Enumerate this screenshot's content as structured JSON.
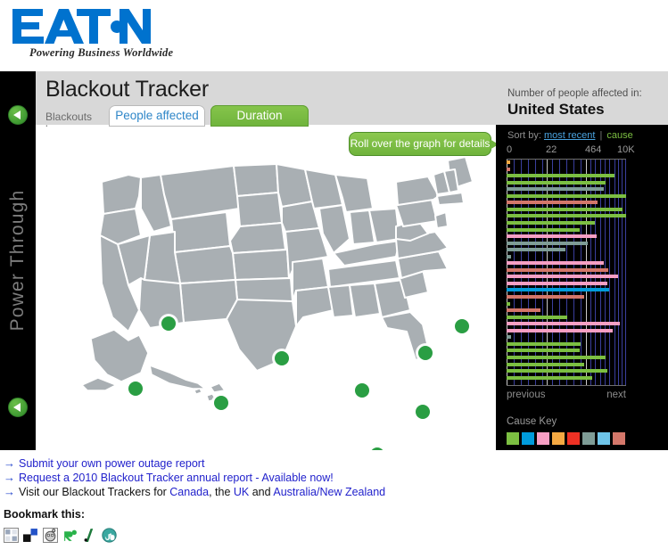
{
  "brand": {
    "logo_text": "EATON",
    "tagline": "Powering Business Worldwide"
  },
  "rail": {
    "vertical_text": "Power Through",
    "top_button": "previous-arrow",
    "bottom_button": "previous-arrow"
  },
  "header": {
    "title": "Blackout Tracker",
    "tabs_prefix": "Blackouts by:",
    "tabs": [
      {
        "label": "People affected",
        "active": true
      },
      {
        "label": "Duration",
        "active": false
      }
    ]
  },
  "map": {
    "callout": "Roll over the graph for details",
    "marker_count": 9,
    "land_color": "#A9AFB3",
    "border_color": "#FFFFFF",
    "marker_color": "#2A9E43"
  },
  "panel": {
    "subtitle": "Number of people affected in:",
    "region": "United States",
    "sort_label": "Sort by:",
    "sort_options": [
      {
        "label": "most recent",
        "active": true,
        "color": "#4AA3E0"
      },
      {
        "label": "cause",
        "active": false,
        "color": "#7CBF42"
      }
    ],
    "sort_separator": "|",
    "previous_label": "previous",
    "next_label": "next",
    "cause_key_title": "Cause Key",
    "cause_key_colors": [
      "#7CBF42",
      "#009BDB",
      "#F79FC4",
      "#F5A942",
      "#EE3124",
      "#7E9C96",
      "#6EC4E8",
      "#D4776A"
    ]
  },
  "chart_data": {
    "type": "bar",
    "orientation": "horizontal",
    "title": "Number of people affected in: United States",
    "xlabel": "",
    "ylabel": "",
    "scale": "log",
    "tick_labels": [
      "0",
      "22",
      "464",
      "10K"
    ],
    "tick_positions_pct": [
      0,
      33.3,
      66.6,
      100
    ],
    "grid": true,
    "legend_position": "below-chart",
    "legend_title": "Cause Key",
    "legend_entries": [
      "#7CBF42",
      "#009BDB",
      "#F79FC4",
      "#F5A942",
      "#EE3124",
      "#7E9C96",
      "#6EC4E8",
      "#D4776A"
    ],
    "values": [
      3,
      3,
      90,
      83,
      81,
      100,
      76,
      97,
      100,
      74,
      61,
      75,
      68,
      49,
      4,
      81,
      85,
      93,
      84,
      86,
      65,
      3,
      28,
      51,
      95,
      89,
      4,
      62,
      61,
      83,
      65,
      84,
      72
    ],
    "colors": [
      "#F5A942",
      "#D4776A",
      "#7CBF42",
      "#7CBF42",
      "#7E9C96",
      "#7CBF42",
      "#D4776A",
      "#7CBF42",
      "#7CBF42",
      "#7CBF42",
      "#7CBF42",
      "#F79FC4",
      "#7E9C96",
      "#7E9C96",
      "#7E9C96",
      "#F79FC4",
      "#D4776A",
      "#F79FC4",
      "#F79FC4",
      "#009BDB",
      "#D4776A",
      "#7CBF42",
      "#D4776A",
      "#7CBF42",
      "#F79FC4",
      "#F79FC4",
      "#7E9C96",
      "#7CBF42",
      "#7CBF42",
      "#7CBF42",
      "#7CBF42",
      "#7CBF42",
      "#7CBF42"
    ]
  },
  "footer": {
    "links": [
      {
        "arrow": "→",
        "segments": [
          {
            "text": "Submit your own power outage report",
            "link": true
          }
        ]
      },
      {
        "arrow": "→",
        "segments": [
          {
            "text": "Request a 2010 Blackout Tracker annual report - Available now!",
            "link": true
          }
        ]
      },
      {
        "arrow": "→",
        "segments": [
          {
            "text": "Visit our Blackout Trackers for ",
            "link": false
          },
          {
            "text": "Canada",
            "link": true
          },
          {
            "text": ", the ",
            "link": false
          },
          {
            "text": "UK",
            "link": true
          },
          {
            "text": " and ",
            "link": false
          },
          {
            "text": "Australia/New Zealand",
            "link": true
          }
        ]
      }
    ],
    "bookmark_title": "Bookmark this:",
    "bookmark_icons": [
      "delicious-icon",
      "digg-icon",
      "reddit-icon",
      "technorati-icon",
      "slashdot-icon",
      "stumbleupon-icon"
    ]
  }
}
